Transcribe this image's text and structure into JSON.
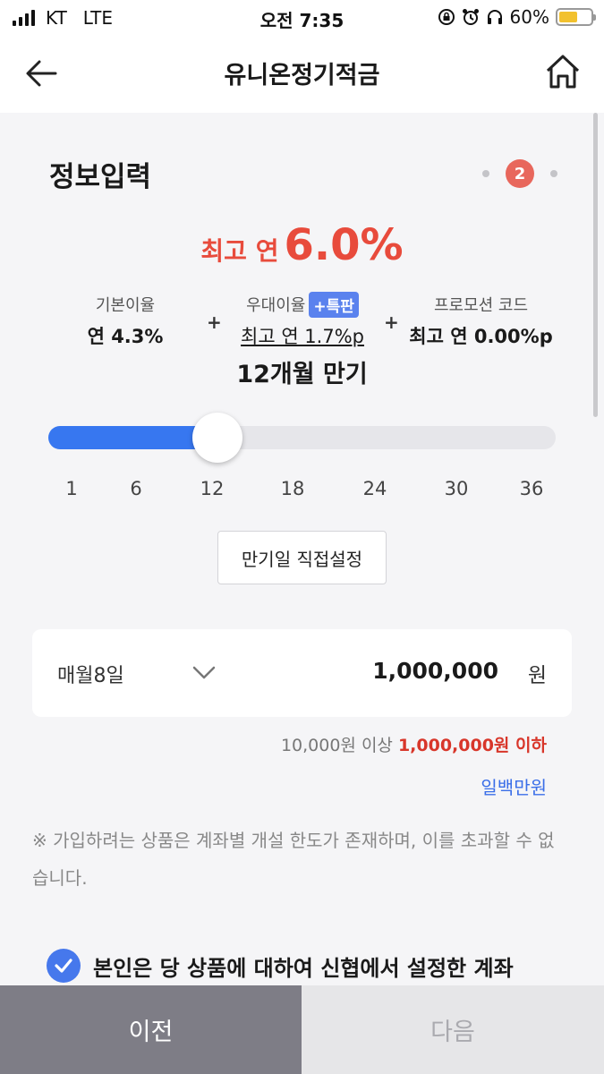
{
  "status_bar": {
    "carrier": "KT",
    "network": "LTE",
    "time": "오전 7:35",
    "battery": "60%",
    "battery_level": 0.6,
    "icons": [
      "signal-icon",
      "rotation-lock-icon",
      "alarm-icon",
      "headphones-icon",
      "battery-icon"
    ]
  },
  "header": {
    "title": "유니온정기적금",
    "back_icon": "back-arrow-icon",
    "home_icon": "home-icon"
  },
  "section": {
    "title": "정보입력",
    "current_step": "2"
  },
  "rate_headline": {
    "prefix": "최고 연",
    "value": "6.0%",
    "color": "#e84b3c"
  },
  "rates": {
    "base_label": "기본이율",
    "base_value": "연 4.3%",
    "plus1": "+",
    "preferential_label": "우대이율",
    "preferential_badge": "+특판",
    "preferential_value": "최고 연 1.7%p",
    "plus2": "+",
    "promo_label": "프로모션 코드",
    "promo_value": "최고 연 0.00%p"
  },
  "term": {
    "label": "12개월 만기",
    "selected_months": 12,
    "ticks": [
      "1",
      "6",
      "12",
      "18",
      "24",
      "30",
      "36"
    ]
  },
  "direct_setting_button": "만기일 직접설정",
  "amount": {
    "payment_day": "매월8일",
    "value": "1,000,000",
    "unit": "원",
    "limit_min": "10,000원 이상",
    "limit_max": "1,000,000원 이하",
    "korean": "일백만원"
  },
  "notice": "※ 가입하려는 상품은 계좌별 개설 한도가 존재하며, 이를 초과할 수 없습니다.",
  "agreement": {
    "text": "본인은 당 상품에 대하여 신협에서 설정한 계좌",
    "checked": true
  },
  "buttons": {
    "prev": "이전",
    "next": "다음"
  },
  "colors": {
    "accent_blue": "#3777f0",
    "accent_red": "#e84b3c",
    "prev_button": "#7e7d86",
    "next_button": "#e6e6e8"
  }
}
